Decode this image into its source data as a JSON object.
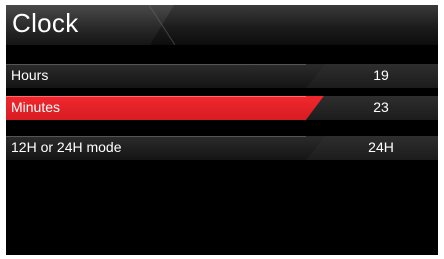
{
  "header": {
    "title": "Clock"
  },
  "settings": [
    {
      "label": "Hours",
      "value": "19"
    },
    {
      "label": "Minutes",
      "value": "23"
    },
    {
      "label": "12H or 24H mode",
      "value": "24H"
    }
  ],
  "colors": {
    "selected": "#e32228",
    "background": "#000000",
    "text": "#ffffff"
  }
}
